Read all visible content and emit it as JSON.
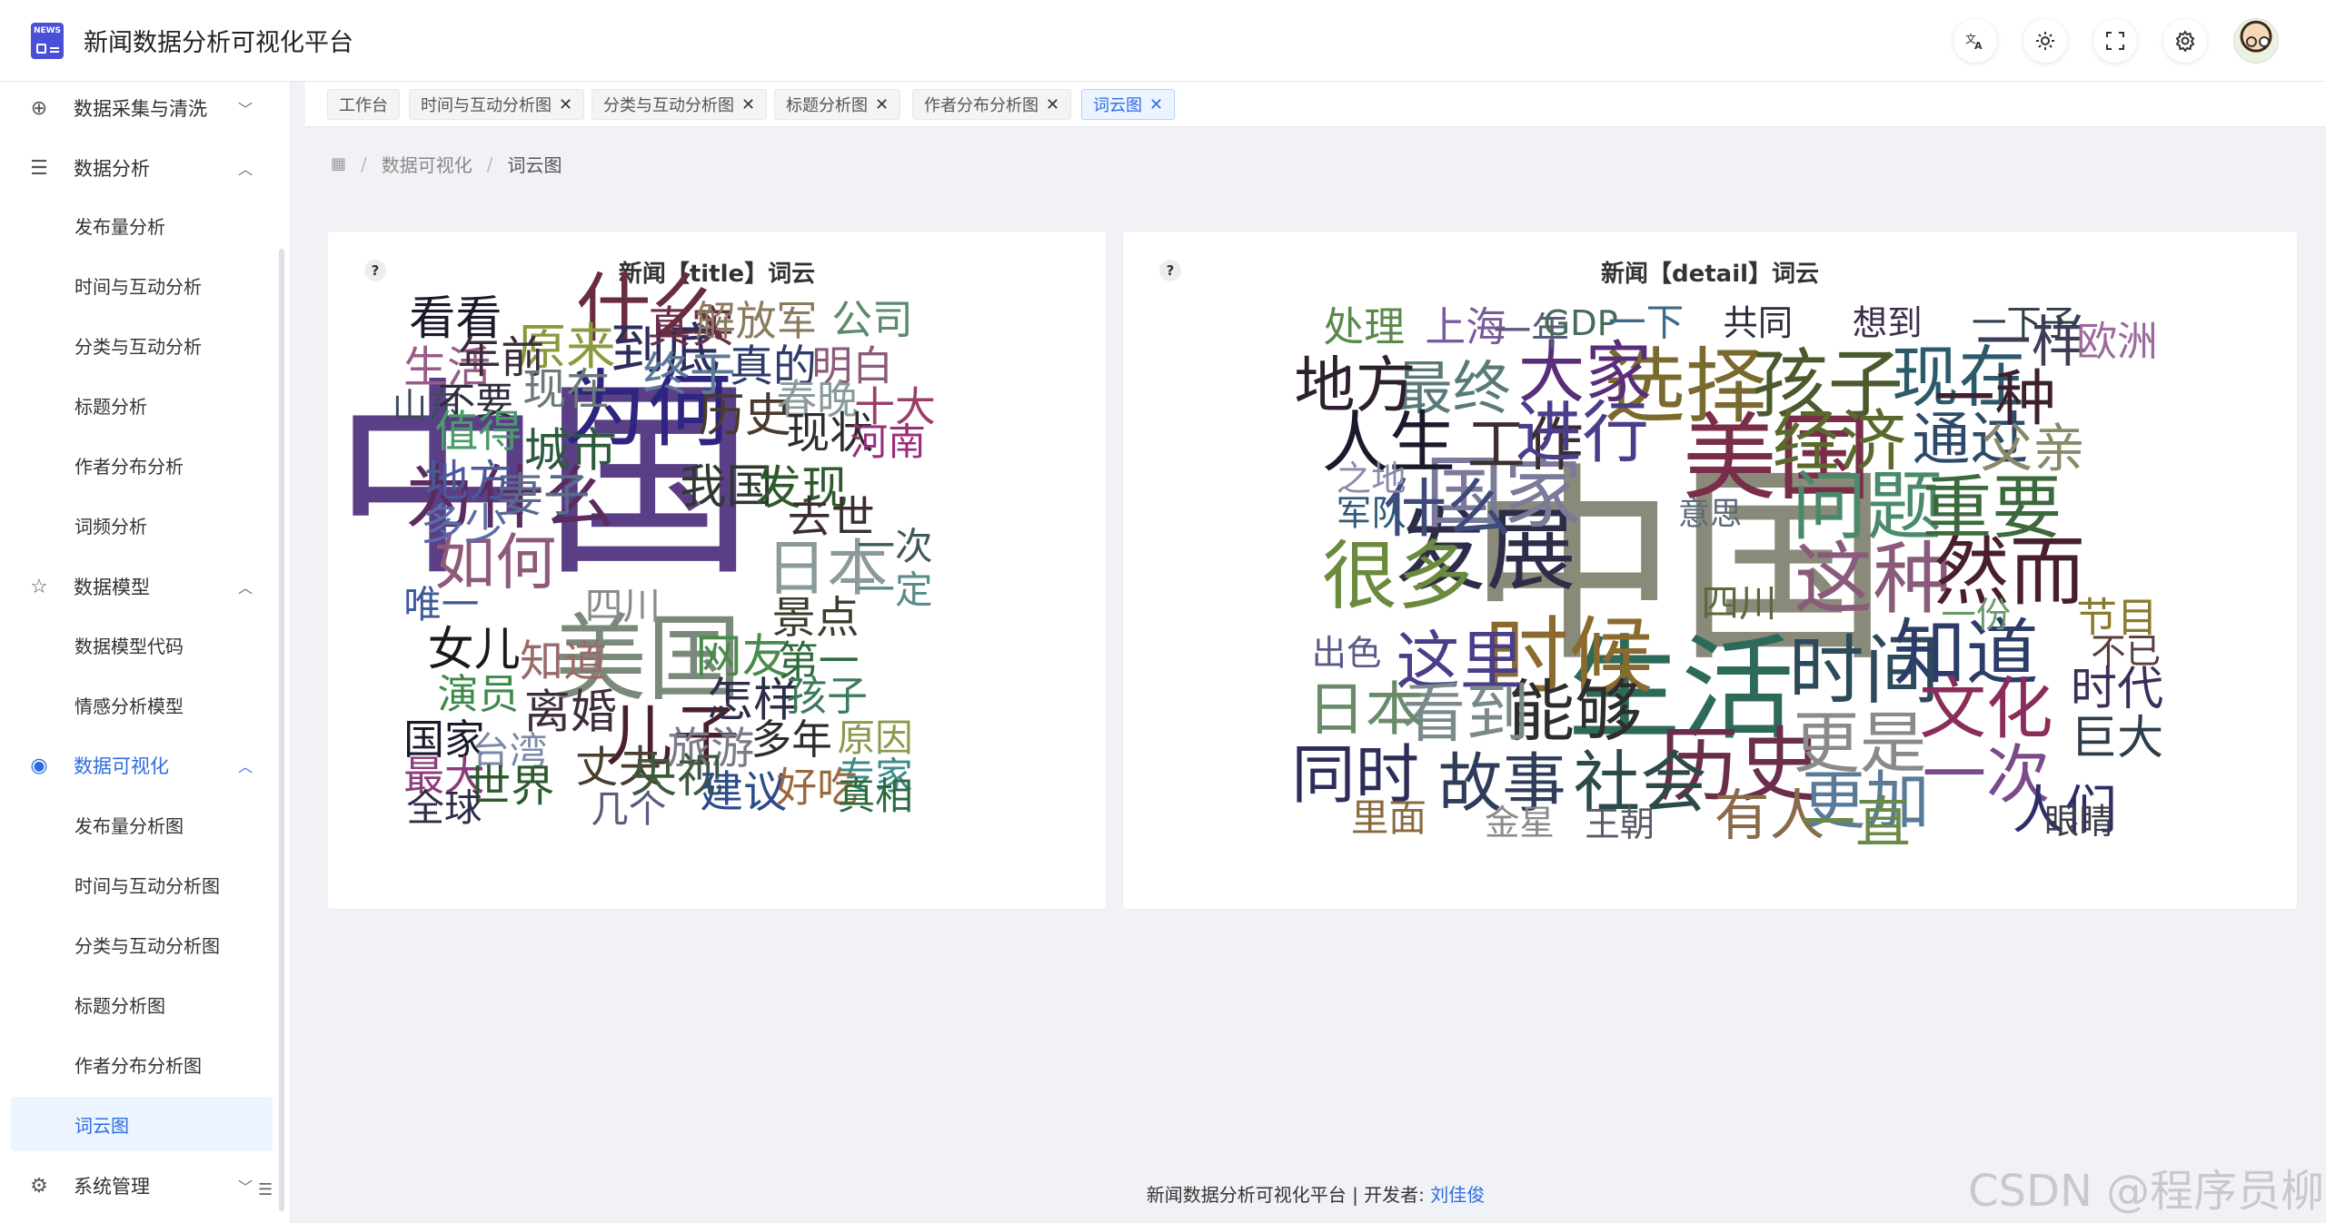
{
  "app": {
    "title": "新闻数据分析可视化平台",
    "logo_text": "NEWS"
  },
  "header_icons": [
    "translate-icon",
    "sun-icon",
    "fullscreen-icon",
    "gear-icon"
  ],
  "sidebar": {
    "items": [
      {
        "label": "数据采集与清洗",
        "icon": "plus-circle-icon",
        "expanded": false
      },
      {
        "label": "数据分析",
        "icon": "list-icon",
        "expanded": true,
        "children": [
          "发布量分析",
          "时间与互动分析",
          "分类与互动分析",
          "标题分析",
          "作者分布分析",
          "词频分析"
        ]
      },
      {
        "label": "数据模型",
        "icon": "star-icon",
        "expanded": true,
        "children": [
          "数据模型代码",
          "情感分析模型"
        ]
      },
      {
        "label": "数据可视化",
        "icon": "eye-icon",
        "expanded": true,
        "active": true,
        "children": [
          "发布量分析图",
          "时间与互动分析图",
          "分类与互动分析图",
          "标题分析图",
          "作者分布分析图",
          "词云图"
        ]
      },
      {
        "label": "系统管理",
        "icon": "gear-icon",
        "expanded": false
      }
    ],
    "active_child": "词云图"
  },
  "tags": [
    {
      "label": "工作台",
      "closable": false
    },
    {
      "label": "时间与互动分析图",
      "closable": true
    },
    {
      "label": "分类与互动分析图",
      "closable": true
    },
    {
      "label": "标题分析图",
      "closable": true
    },
    {
      "label": "作者分布分析图",
      "closable": true
    },
    {
      "label": "词云图",
      "closable": true,
      "active": true
    }
  ],
  "breadcrumb": {
    "level1": "数据可视化",
    "level2": "词云图"
  },
  "cards": {
    "title_cloud": {
      "title": "新闻【title】词云",
      "help": "?",
      "words": [
        {
          "t": "中国",
          "c": "#5b3f86"
        },
        {
          "t": "为何",
          "c": "#2d2580"
        },
        {
          "t": "美国",
          "c": "#7a8a7a"
        },
        {
          "t": "什么",
          "c": "#6a2d3d"
        },
        {
          "t": "为什么",
          "c": "#5a2b5e"
        },
        {
          "t": "如何",
          "c": "#8e5a7a"
        },
        {
          "t": "日本",
          "c": "#8a9a9a"
        },
        {
          "t": "儿子",
          "c": "#4a1f2d"
        },
        {
          "t": "到底",
          "c": "#2d2d5e"
        },
        {
          "t": "原来",
          "c": "#8a9a3d"
        },
        {
          "t": "真实",
          "c": "#6a2d4a"
        },
        {
          "t": "解放军",
          "c": "#8a7a5e"
        },
        {
          "t": "公司",
          "c": "#5a8a6a"
        },
        {
          "t": "看看",
          "c": "#1a1a2a"
        },
        {
          "t": "生活",
          "c": "#9a5a8a"
        },
        {
          "t": "年前",
          "c": "#3d2a3d"
        },
        {
          "t": "终于",
          "c": "#5a7a9a"
        },
        {
          "t": "真的",
          "c": "#2d3a6a"
        },
        {
          "t": "明白",
          "c": "#8a5a7a"
        },
        {
          "t": "山东",
          "c": "#3d4a5a"
        },
        {
          "t": "不要",
          "c": "#2d2d3d"
        },
        {
          "t": "现在",
          "c": "#6a7a7a"
        },
        {
          "t": "历史",
          "c": "#4a3a2d"
        },
        {
          "t": "春晚",
          "c": "#8a9a9a"
        },
        {
          "t": "十大",
          "c": "#9a3d6a"
        },
        {
          "t": "值得",
          "c": "#4a9a6a"
        },
        {
          "t": "城市",
          "c": "#2d5a3d"
        },
        {
          "t": "现状",
          "c": "#2d2d2d"
        },
        {
          "t": "河南",
          "c": "#9a2d7a"
        },
        {
          "t": "地方",
          "c": "#4a5a9a"
        },
        {
          "t": "妻子",
          "c": "#5a6a8a"
        },
        {
          "t": "我国",
          "c": "#2d3a2d"
        },
        {
          "t": "发现",
          "c": "#2d5a2d"
        },
        {
          "t": "多少",
          "c": "#5a6aaa"
        },
        {
          "t": "去世",
          "c": "#3d2d2d"
        },
        {
          "t": "一次",
          "c": "#3d5a5a"
        },
        {
          "t": "一定",
          "c": "#5a8a8a"
        },
        {
          "t": "唯一",
          "c": "#3d5a9a"
        },
        {
          "t": "四川",
          "c": "#8a8a8a"
        },
        {
          "t": "景点",
          "c": "#3d3d2d"
        },
        {
          "t": "女儿",
          "c": "#1a1a1a"
        },
        {
          "t": "知道",
          "c": "#9a6a6a"
        },
        {
          "t": "网友",
          "c": "#4a8a4a"
        },
        {
          "t": "第一",
          "c": "#2d6a3d"
        },
        {
          "t": "演员",
          "c": "#3d8a4a"
        },
        {
          "t": "离婚",
          "c": "#3d2d3d"
        },
        {
          "t": "怎样",
          "c": "#2d2d4a"
        },
        {
          "t": "孩子",
          "c": "#3d7a5a"
        },
        {
          "t": "国家",
          "c": "#1a1a2d"
        },
        {
          "t": "台湾",
          "c": "#7a8aaa"
        },
        {
          "t": "丈夫",
          "c": "#4a3d2d"
        },
        {
          "t": "旅游",
          "c": "#7a7a8a"
        },
        {
          "t": "多年",
          "c": "#2d2d2d"
        },
        {
          "t": "原因",
          "c": "#8a9a4a"
        },
        {
          "t": "最大",
          "c": "#8a3d7a"
        },
        {
          "t": "世界",
          "c": "#2d5a2d"
        },
        {
          "t": "央视",
          "c": "#3d5a3d"
        },
        {
          "t": "专家",
          "c": "#3d8a8a"
        },
        {
          "t": "全球",
          "c": "#2d2d4a"
        },
        {
          "t": "几个",
          "c": "#5a5a7a"
        },
        {
          "t": "建议",
          "c": "#2d4a8a"
        },
        {
          "t": "好吃",
          "c": "#9a6a3d"
        },
        {
          "t": "真相",
          "c": "#2d6a3d"
        }
      ]
    },
    "detail_cloud": {
      "title": "新闻【detail】词云",
      "help": "?",
      "words": [
        {
          "t": "中国",
          "c": "#8a8a7a"
        },
        {
          "t": "生活",
          "c": "#2d6a5a"
        },
        {
          "t": "美国",
          "c": "#7a2d4a"
        },
        {
          "t": "发展",
          "c": "#2d2d4a"
        },
        {
          "t": "国家",
          "c": "#7a7a9a"
        },
        {
          "t": "选择",
          "c": "#7a6a2d"
        },
        {
          "t": "孩子",
          "c": "#4a5a2d"
        },
        {
          "t": "现在",
          "c": "#2d5a6a"
        },
        {
          "t": "时候",
          "c": "#8a6a2d"
        },
        {
          "t": "历史",
          "c": "#6a2d4a"
        },
        {
          "t": "时间",
          "c": "#2d4a5a"
        },
        {
          "t": "这种",
          "c": "#8a5a7a"
        },
        {
          "t": "然而",
          "c": "#4a1f2d"
        },
        {
          "t": "问题",
          "c": "#4a8a6a"
        },
        {
          "t": "重要",
          "c": "#3d6a3d"
        },
        {
          "t": "经济",
          "c": "#5a6a2d"
        },
        {
          "t": "通过",
          "c": "#2d4a6a"
        },
        {
          "t": "大家",
          "c": "#5a2d7a"
        },
        {
          "t": "最终",
          "c": "#5a7a7a"
        },
        {
          "t": "地方",
          "c": "#2d1f2d"
        },
        {
          "t": "人生",
          "c": "#1a1a2d"
        },
        {
          "t": "工作",
          "c": "#3d2d2d"
        },
        {
          "t": "进行",
          "c": "#4a3d8a"
        },
        {
          "t": "什么",
          "c": "#3d4a7a"
        },
        {
          "t": "很多",
          "c": "#6a8a3d"
        },
        {
          "t": "这里",
          "c": "#4a3d8a"
        },
        {
          "t": "知道",
          "c": "#2d3d6a"
        },
        {
          "t": "文化",
          "c": "#8a2d5a"
        },
        {
          "t": "能够",
          "c": "#2d2d2d"
        },
        {
          "t": "看到",
          "c": "#7a8a8a"
        },
        {
          "t": "日本",
          "c": "#6a8a6a"
        },
        {
          "t": "更是",
          "c": "#8a8a8a"
        },
        {
          "t": "同时",
          "c": "#2d2d5a"
        },
        {
          "t": "故事",
          "c": "#2d3d5a"
        },
        {
          "t": "社会",
          "c": "#2d4a4a"
        },
        {
          "t": "一次",
          "c": "#7a4a8a"
        },
        {
          "t": "更加",
          "c": "#5a7a9a"
        },
        {
          "t": "有人",
          "c": "#8a6a4a"
        },
        {
          "t": "一直",
          "c": "#6a8a4a"
        },
        {
          "t": "人们",
          "c": "#2d2d6a"
        },
        {
          "t": "一种",
          "c": "#3d1f2d"
        },
        {
          "t": "一样",
          "c": "#3d3d5a"
        },
        {
          "t": "父亲",
          "c": "#8a8a6a"
        },
        {
          "t": "欧洲",
          "c": "#9a6a9a"
        },
        {
          "t": "处理",
          "c": "#5a8a4a"
        },
        {
          "t": "上海",
          "c": "#7a5a9a"
        },
        {
          "t": "一年",
          "c": "#5a5a7a"
        },
        {
          "t": "GDP",
          "c": "#4a6a5a"
        },
        {
          "t": "一下",
          "c": "#3d6a8a"
        },
        {
          "t": "共同",
          "c": "#2d2d3d"
        },
        {
          "t": "想到",
          "c": "#3d2d4a"
        },
        {
          "t": "一下子",
          "c": "#2d3d4a"
        },
        {
          "t": "之地",
          "c": "#8a8aaa"
        },
        {
          "t": "军队",
          "c": "#2d5a7a"
        },
        {
          "t": "意思",
          "c": "#5a6a7a"
        },
        {
          "t": "四川",
          "c": "#5a6a3d"
        },
        {
          "t": "出色",
          "c": "#5a5a8a"
        },
        {
          "t": "一份",
          "c": "#6a9a6a"
        },
        {
          "t": "节目",
          "c": "#8a7a2d"
        },
        {
          "t": "不已",
          "c": "#5a3d3d"
        },
        {
          "t": "时代",
          "c": "#3d2d5a"
        },
        {
          "t": "巨大",
          "c": "#2d3d4a"
        },
        {
          "t": "里面",
          "c": "#8a6a3d"
        },
        {
          "t": "金星",
          "c": "#8a8a8a"
        },
        {
          "t": "王朝",
          "c": "#5a5a6a"
        },
        {
          "t": "眼睛",
          "c": "#3d3d4a"
        }
      ]
    }
  },
  "footer": {
    "text": "新闻数据分析可视化平台 | 开发者: ",
    "author": "刘佳俊"
  },
  "watermark": "CSDN @程序员柳"
}
